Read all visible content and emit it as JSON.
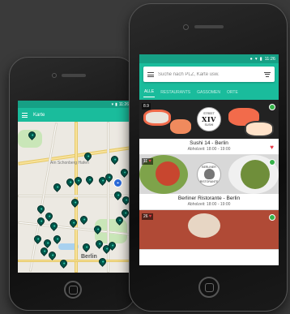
{
  "left_phone": {
    "app_title": "Karte",
    "status_time": "11:26",
    "map_labels": {
      "city": "Berlin",
      "place": "Am Schonberg Hafen"
    },
    "locate_icon": "locate-icon"
  },
  "right_phone": {
    "status_time": "11:26",
    "search_placeholder": "Suche nach PLZ, Karte usw.",
    "tabs": [
      "ALLE",
      "RESTAURANTS",
      "GASSOMEN",
      "ORTE"
    ],
    "cards": [
      {
        "rating": "8.9",
        "logo_top": "STREET",
        "logo_main": "XIV",
        "logo_bottom": "SUSHI",
        "title": "Sushi 14 - Berlin",
        "subtitle": "Abholzeit: 18:00 - 19:00",
        "favorite": true
      },
      {
        "rating": "11",
        "logo_top": "BERLINER",
        "logo_main": "",
        "logo_bottom": "RISTORANTE",
        "title": "Berliner Ristorante - Berlin",
        "subtitle": "Abholzeit: 18:00 - 19:00",
        "favorite": false
      },
      {
        "rating": "26",
        "title": "",
        "subtitle": ""
      }
    ]
  },
  "colors": {
    "teal": "#1abc9c",
    "teal_dark": "#16a085",
    "pin": "#00574b",
    "heart": "#e63946",
    "badge_green": "#36b24a"
  }
}
